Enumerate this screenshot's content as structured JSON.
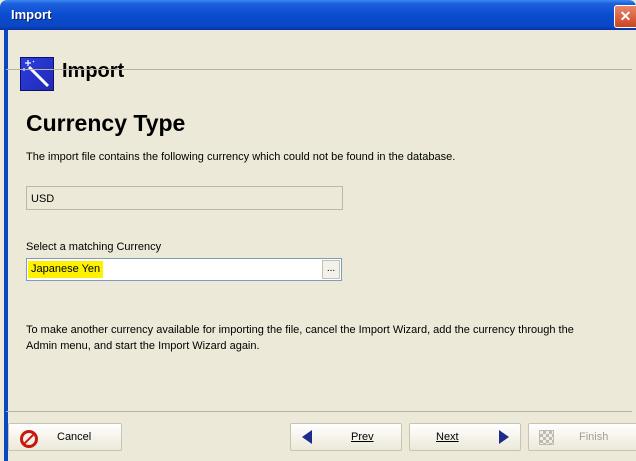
{
  "window": {
    "title": "Import",
    "close_glyph": "✕"
  },
  "header": {
    "title": "Import",
    "icon": "wizard-icon"
  },
  "page": {
    "section_title": "Currency Type",
    "description": "The import file contains the following currency which could not be found in the database.",
    "unmatched_currency": "USD",
    "select_label": "Select a matching Currency",
    "selected_currency": "Japanese Yen",
    "browse_label": "...",
    "note": "To make another currency available for importing the file, cancel the Import Wizard, add the currency through the Admin menu, and start the Import Wizard again."
  },
  "buttons": {
    "cancel": "Cancel",
    "prev": "Prev",
    "next": "Next",
    "finish": "Finish"
  },
  "colors": {
    "title_bar": "#0b47c3",
    "highlight": "#fff200",
    "cancel_icon": "#c8170d"
  }
}
